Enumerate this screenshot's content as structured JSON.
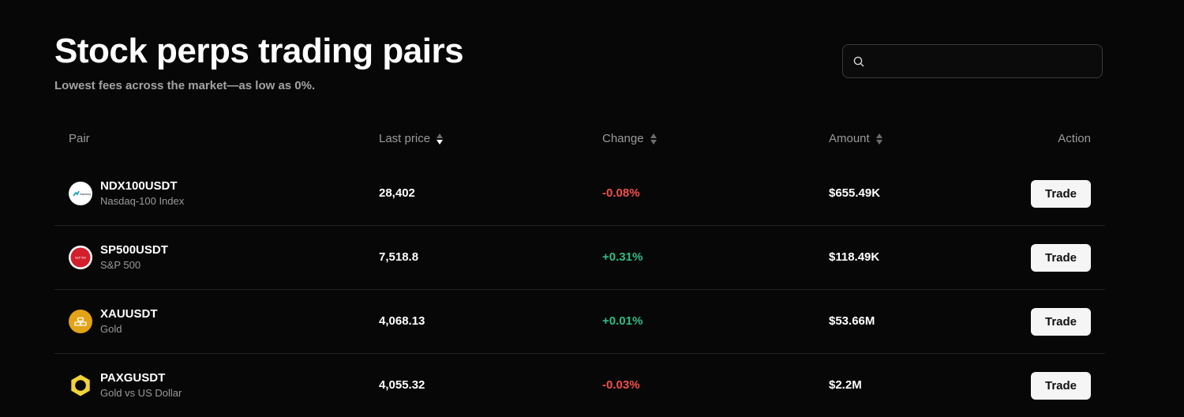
{
  "header": {
    "title": "Stock perps trading pairs",
    "subtitle": "Lowest fees across the market—as low as 0%."
  },
  "search": {
    "value": "",
    "placeholder": "",
    "icon": "search-icon"
  },
  "table": {
    "columns": {
      "pair": "Pair",
      "last_price": "Last price",
      "change": "Change",
      "amount": "Amount",
      "action": "Action"
    },
    "sort": {
      "column": "last_price",
      "direction": "descending"
    },
    "rows": [
      {
        "symbol": "NDX100USDT",
        "name": "Nasdaq-100 Index",
        "logo_text": "Nasdaq",
        "icon": "nasdaq-logo-icon",
        "last_price": "28,402",
        "change": "-0.08%",
        "amount": "$655.49K",
        "action_label": "Trade"
      },
      {
        "symbol": "SP500USDT",
        "name": "S&P 500",
        "logo_text": "S&P 500",
        "icon": "sp500-logo-icon",
        "last_price": "7,518.8",
        "change": "+0.31%",
        "amount": "$118.49K",
        "action_label": "Trade"
      },
      {
        "symbol": "XAUUSDT",
        "name": "Gold",
        "icon": "gold-bars-icon",
        "last_price": "4,068.13",
        "change": "+0.01%",
        "amount": "$53.66M",
        "action_label": "Trade"
      },
      {
        "symbol": "PAXGUSDT",
        "name": "Gold vs US Dollar",
        "icon": "paxg-hexagon-icon",
        "last_price": "4,055.32",
        "change": "-0.03%",
        "amount": "$2.2M",
        "action_label": "Trade"
      }
    ]
  },
  "colors": {
    "background": "#070707",
    "negative": "#f0504e",
    "positive": "#2ebd85",
    "muted_text": "#9a9a9a",
    "button_bg": "#f5f5f5"
  }
}
